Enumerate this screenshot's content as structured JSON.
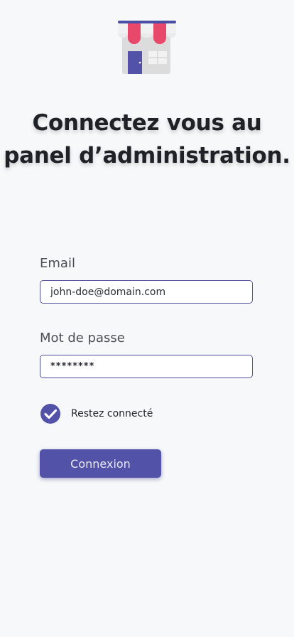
{
  "app": {
    "logo": "store-icon"
  },
  "header": {
    "title_line1": "Connectez vous au",
    "title_line2": "panel d’administration."
  },
  "form": {
    "email_label": "Email",
    "email_value": "john-doe@domain.com",
    "password_label": "Mot de passe",
    "password_value": "********",
    "remember_label": "Restez connecté",
    "remember_checked": true,
    "submit_label": "Connexion"
  },
  "colors": {
    "accent": "#5252a8",
    "awning_red": "#e8496a",
    "background": "#f7f8fa"
  }
}
